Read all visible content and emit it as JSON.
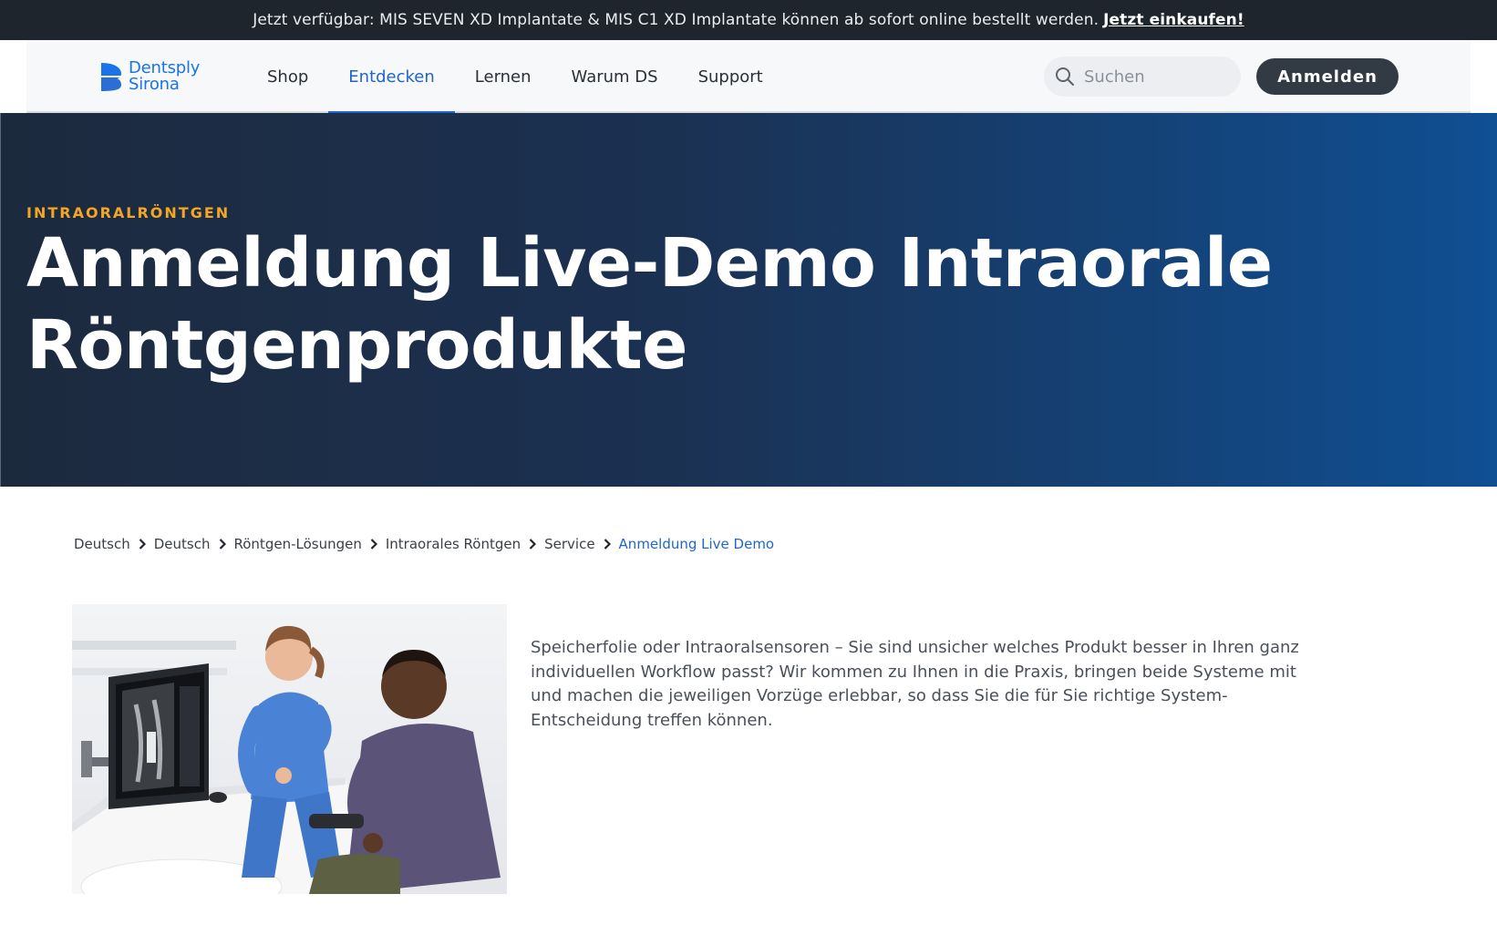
{
  "announcement": {
    "text": "Jetzt verfügbar: MIS SEVEN XD Implantate & MIS C1 XD Implantate können ab sofort online bestellt werden.",
    "link_label": "Jetzt einkaufen!"
  },
  "header": {
    "logo": {
      "line1": "Dentsply",
      "line2": "Sirona"
    },
    "nav": [
      {
        "label": "Shop",
        "active": false
      },
      {
        "label": "Entdecken",
        "active": true
      },
      {
        "label": "Lernen",
        "active": false
      },
      {
        "label": "Warum DS",
        "active": false
      },
      {
        "label": "Support",
        "active": false
      }
    ],
    "search_placeholder": "Suchen",
    "signin_label": "Anmelden"
  },
  "hero": {
    "eyebrow": "INTRAORALRÖNTGEN",
    "title": "Anmeldung Live-Demo Intraorale Röntgenprodukte"
  },
  "breadcrumb": [
    {
      "label": "Deutsch"
    },
    {
      "label": "Deutsch"
    },
    {
      "label": "Röntgen-Lösungen"
    },
    {
      "label": "Intraorales Röntgen"
    },
    {
      "label": "Service"
    },
    {
      "label": "Anmeldung Live Demo"
    }
  ],
  "content": {
    "intro": "Speicherfolie oder Intraoralsensoren – Sie sind unsicher welches Produkt besser in Ihren ganz individuellen Workflow passt? Wir kommen zu Ihnen in die Praxis, bringen beide Systeme mit und machen die jeweiligen Vorzüge erlebbar, so dass Sie die für Sie richtige System-Entscheidung treffen können."
  },
  "colors": {
    "accent_blue": "#1f66c7",
    "eyebrow_orange": "#f4a623",
    "announcement_bg": "#1f252c",
    "button_dark": "#323a44"
  }
}
